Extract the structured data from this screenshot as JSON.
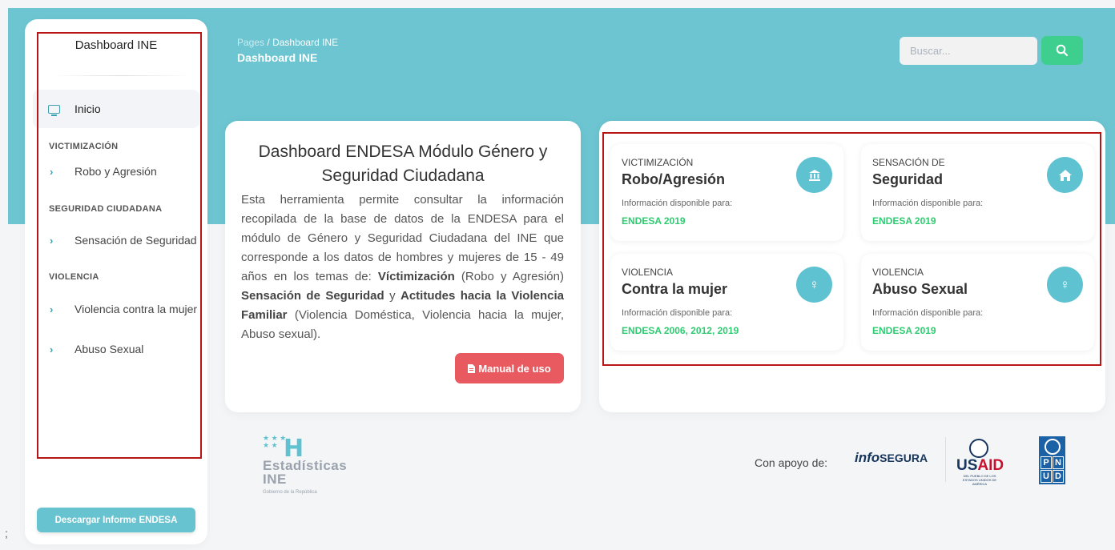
{
  "sidebar": {
    "title": "Dashboard INE",
    "active_item": "Inicio",
    "sections": [
      {
        "label": "VICTIMIZACIÓN",
        "items": [
          "Robo y Agresión"
        ]
      },
      {
        "label": "SEGURIDAD CIUDADANA",
        "items": [
          "Sensación de Seguridad"
        ]
      },
      {
        "label": "VIOLENCIA",
        "items": [
          "Violencia contra la mujer",
          "Abuso Sexual"
        ]
      }
    ],
    "download_label": "Descargar Informe ENDESA"
  },
  "header": {
    "breadcrumb_root": "Pages",
    "breadcrumb_sep": "/",
    "breadcrumb_current": "Dashboard INE",
    "page_title": "Dashboard INE",
    "search_placeholder": "Buscar..."
  },
  "info_card": {
    "title": "Dashboard ENDESA Módulo Género y Seguridad Ciudadana",
    "body_parts": {
      "p1": "Esta herramienta permite consultar la información recopilada de la base de datos de la ENDESA para el módulo de Género y Seguridad Ciudadana del INE que corresponde a los datos de hombres y mujeres de 15 - 49 años en los temas de: ",
      "b1": "Víctimización",
      "p2": " (Robo y Agresión) ",
      "b2": "Sensación de Seguridad",
      "p3": " y ",
      "b3": "Actitudes hacia la Violencia Familiar",
      "p4": " (Violencia Doméstica, Violencia hacia la mujer, Abuso sexual)."
    },
    "manual_label": "Manual de uso"
  },
  "stat_cards": [
    {
      "category": "VICTIMIZACIÓN",
      "title": "Robo/Agresión",
      "info": "Información disponible para:",
      "years": "ENDESA 2019",
      "icon": "bank-icon"
    },
    {
      "category": "SENSACIÓN DE",
      "title": "Seguridad",
      "info": "Información disponible para:",
      "years": "ENDESA 2019",
      "icon": "home-icon"
    },
    {
      "category": "VIOLENCIA",
      "title": "Contra la mujer",
      "info": "Información disponible para:",
      "years": "ENDESA 2006, 2012, 2019",
      "icon": "female-icon"
    },
    {
      "category": "VIOLENCIA",
      "title": "Abuso Sexual",
      "info": "Información disponible para:",
      "years": "ENDESA 2019",
      "icon": "female-icon"
    }
  ],
  "footer": {
    "ine_logo": {
      "mark": "H",
      "name_line1": "Estadísticas",
      "name_line2": "INE",
      "subtitle": "Gobierno de la República"
    },
    "support_label": "Con apoyo de:",
    "partners": {
      "infosegura_prefix": "info",
      "infosegura_suffix": "SEGURA",
      "usaid_pre": "US",
      "usaid_post": "AID",
      "usaid_sub": "DEL PUEBLO DE LOS ESTADOS UNIDOS DE AMÉRICA",
      "pnud_letters": [
        "P",
        "N",
        "U",
        "D"
      ]
    }
  },
  "colors": {
    "hero": "#6cc5d1",
    "accent": "#5fc2d1",
    "search_button": "#3ecf8e",
    "manual_button": "#e85a5f",
    "years_text": "#2ecc71",
    "highlight_border": "#b81616"
  }
}
